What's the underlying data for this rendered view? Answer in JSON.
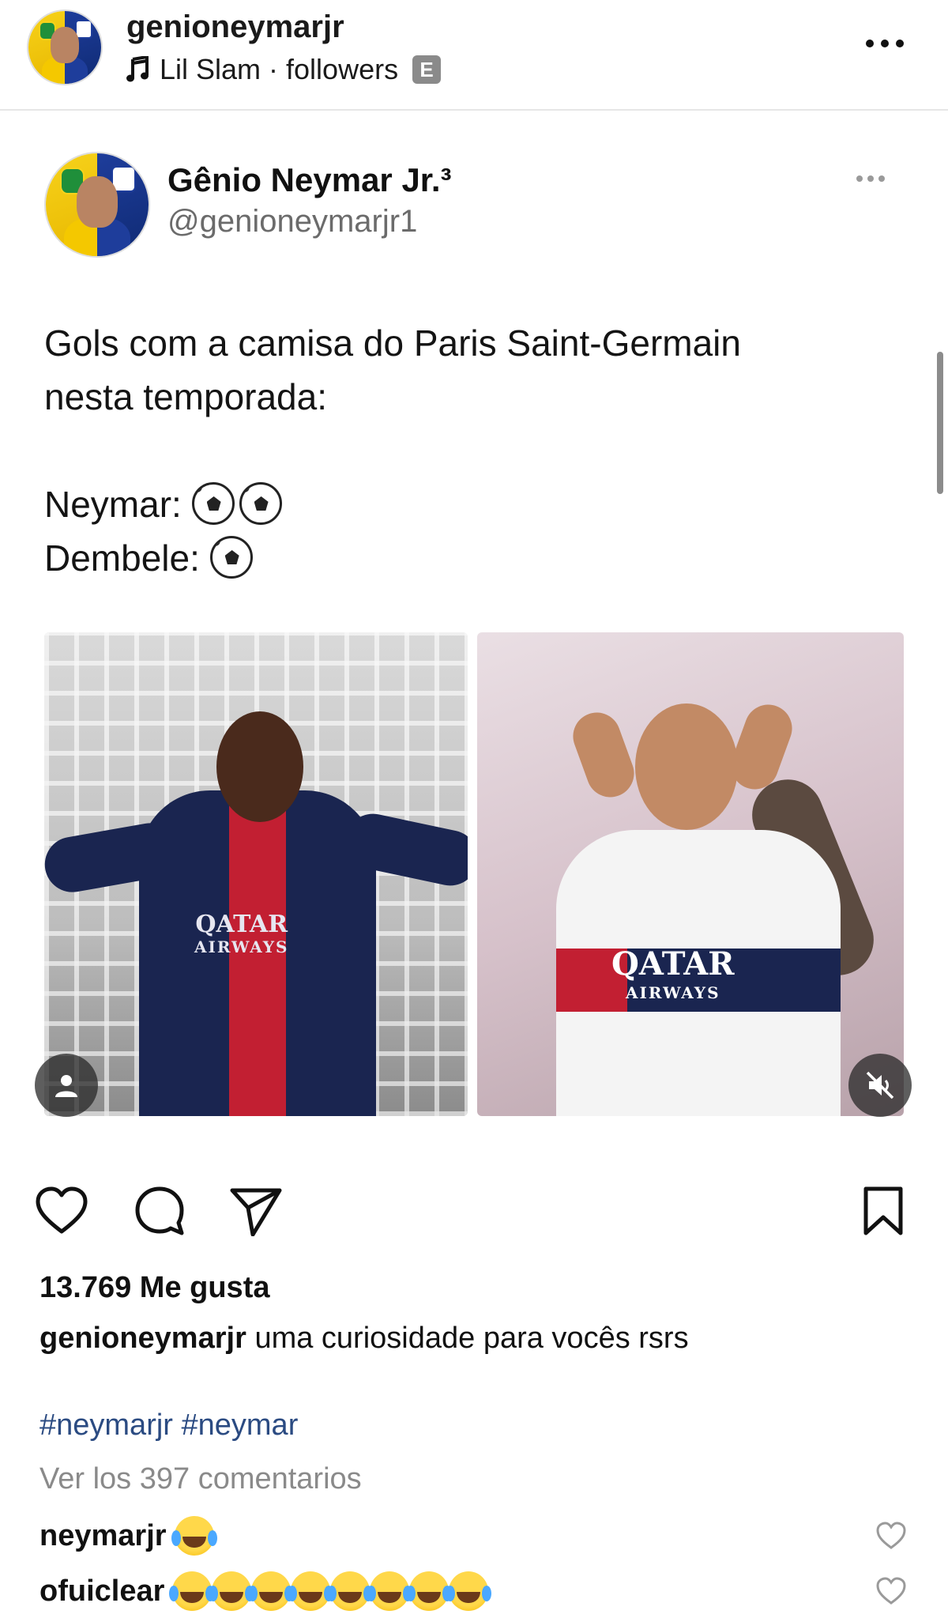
{
  "header": {
    "username": "genioneymarjr",
    "music_label": "Lil Slam · followers",
    "explicit_badge": "E",
    "more_icon": "more-horizontal-icon"
  },
  "tweet": {
    "display_name": "Gênio Neymar Jr.³",
    "handle": "@genioneymarjr1",
    "lines": [
      "Gols com a camisa do Paris Saint-Germain",
      "nesta temporada:",
      "",
      "Neymar:",
      "Dembele:"
    ],
    "neymar_goals": 2,
    "dembele_goals": 1,
    "goal_icon": "soccer-ball-icon"
  },
  "photos": {
    "left_sponsor_top": "QATAR",
    "left_sponsor_bottom": "AIRWAYS",
    "right_sponsor_top": "QATAR",
    "right_sponsor_bottom": "AIRWAYS",
    "tag_icon": "user-tag-icon",
    "mute_icon": "muted-speaker-icon"
  },
  "actions": {
    "like_icon": "heart-icon",
    "comment_icon": "comment-icon",
    "share_icon": "send-icon",
    "save_icon": "bookmark-icon"
  },
  "post": {
    "likes_text": "13.769 Me gusta",
    "caption_user": "genioneymarjr",
    "caption_text": "uma curiosidade para vocês rsrs",
    "hashtags": "#neymarjr #neymar",
    "view_comments": "Ver los 397 comentarios"
  },
  "comments": [
    {
      "user": "neymarjr",
      "emoji_count": 1
    },
    {
      "user": "ofuiclear",
      "emoji_count": 8
    }
  ],
  "colors": {
    "hashtag": "#2b4b82",
    "muted_text": "#8a8a8a",
    "psg_navy": "#1a2550",
    "psg_red": "#c21f32"
  }
}
